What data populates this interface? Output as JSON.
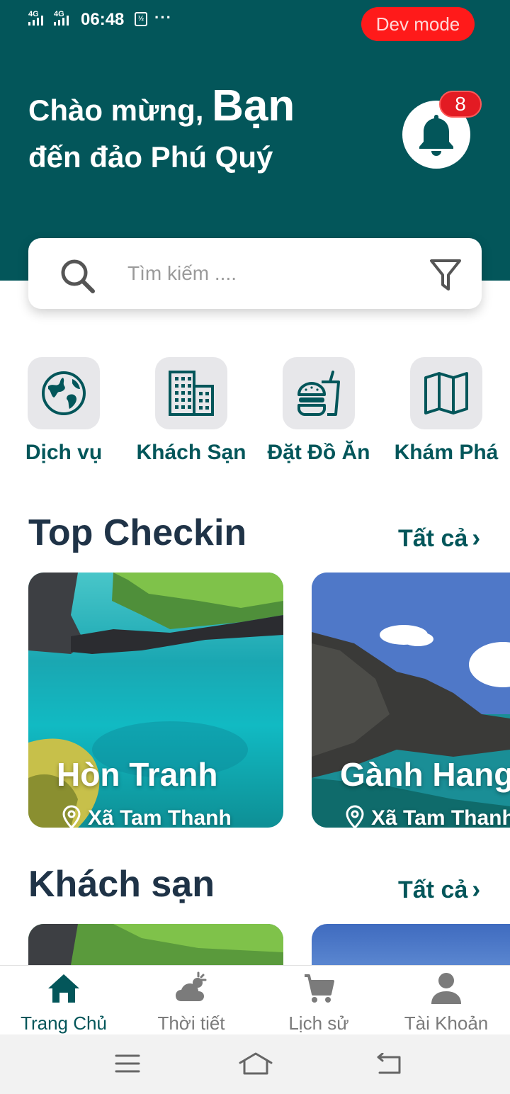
{
  "status_bar": {
    "network1": "4G",
    "network2": "4G",
    "time": "06:48",
    "more": "···",
    "dev_mode": "Dev mode"
  },
  "header": {
    "greeting": "Chào mừng,",
    "name": "Bạn",
    "subtitle": "đến đảo Phú Quý",
    "notification_count": "8",
    "background_color": "#03565a"
  },
  "search": {
    "placeholder": "Tìm kiếm ....",
    "value": ""
  },
  "categories": [
    {
      "label": "Dịch vụ",
      "icon": "globe-icon"
    },
    {
      "label": "Khách Sạn",
      "icon": "building-icon"
    },
    {
      "label": "Đặt Đồ Ăn",
      "icon": "burger-drink-icon"
    },
    {
      "label": "Khám Phá",
      "icon": "map-icon"
    }
  ],
  "top_checkin": {
    "title": "Top Checkin",
    "see_all": "Tất cả",
    "cards": [
      {
        "title": "Hòn Tranh",
        "location": "Xã Tam Thanh"
      },
      {
        "title": "Gành Hang",
        "location": "Xã Tam Thanh"
      }
    ]
  },
  "hotels": {
    "title": "Khách sạn",
    "see_all": "Tất cả"
  },
  "bottom_nav": [
    {
      "label": "Trang Chủ",
      "icon": "home-icon",
      "active": true
    },
    {
      "label": "Thời tiết",
      "icon": "weather-icon",
      "active": false
    },
    {
      "label": "Lịch sử",
      "icon": "cart-icon",
      "active": false
    },
    {
      "label": "Tài Khoản",
      "icon": "user-icon",
      "active": false
    }
  ],
  "colors": {
    "primary": "#03565a",
    "heading": "#1f3347",
    "badge": "#e31b23",
    "dev_mode": "#ff1a1a"
  }
}
